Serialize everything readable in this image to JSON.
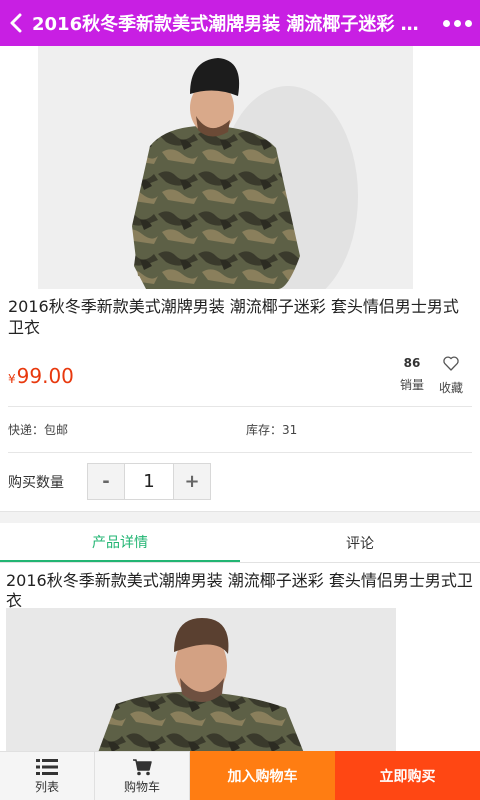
{
  "header": {
    "title": "2016秋冬季新款美式潮牌男装 潮流椰子迷彩 套头情侣男士男式卫衣"
  },
  "product": {
    "title": "2016秋冬季新款美式潮牌男装 潮流椰子迷彩 套头情侣男士男式卫衣",
    "currency_symbol": "¥",
    "price": "99.00",
    "sales_count": "86",
    "sales_label": "销量",
    "favorite_label": "收藏",
    "shipping_label": "快递：包邮",
    "stock_label": "库存：31"
  },
  "quantity": {
    "label": "购买数量",
    "minus": "-",
    "value": "1",
    "plus": "+"
  },
  "tabs": [
    {
      "label": "产品详情",
      "active": true
    },
    {
      "label": "评论",
      "active": false
    }
  ],
  "detail": {
    "title": "2016秋冬季新款美式潮牌男装 潮流椰子迷彩 套头情侣男士男式卫衣"
  },
  "bottom_bar": {
    "list_label": "列表",
    "cart_label": "购物车",
    "add_to_cart": "加入购物车",
    "buy_now": "立即购买"
  },
  "colors": {
    "header_bg": "#c81fe3",
    "price": "#e8380d",
    "tab_active": "#22b573",
    "add_cart_bg": "#ff7d12",
    "buy_now_bg": "#ff4713"
  },
  "icons": {
    "back": "chevron-left-icon",
    "more": "more-dots-icon",
    "favorite": "heart-icon",
    "list": "list-icon",
    "cart": "cart-icon"
  }
}
